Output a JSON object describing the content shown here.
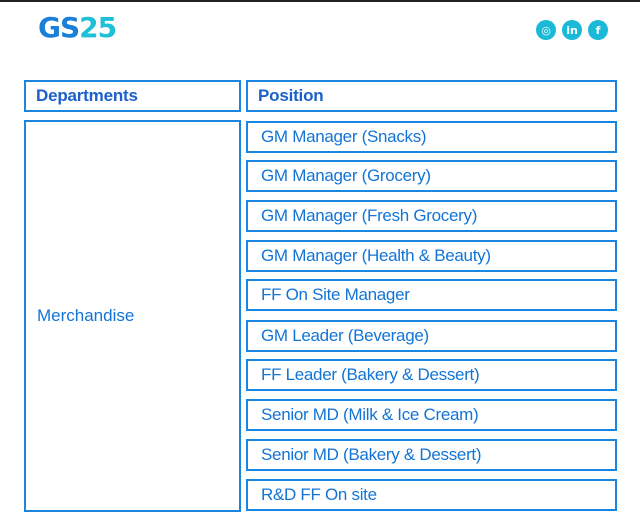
{
  "brand": {
    "logo_gs": "GS",
    "logo_num": "25"
  },
  "social": [
    {
      "icon": "instagram-icon",
      "glyph": "◎"
    },
    {
      "icon": "linkedin-icon",
      "glyph": "in"
    },
    {
      "icon": "facebook-icon",
      "glyph": "f"
    }
  ],
  "colors": {
    "primary": "#1b86e0",
    "header_text": "#1c60c9",
    "body_text": "#1274d6",
    "social": "#1ab9d8",
    "logo_accent": "#1ec0d6"
  },
  "table": {
    "headers": {
      "departments": "Departments",
      "position": "Position"
    },
    "department": "Merchandise",
    "positions": [
      "GM Manager (Snacks)",
      "GM Manager (Grocery)",
      "GM Manager (Fresh Grocery)",
      "GM Manager (Health & Beauty)",
      "FF On Site Manager",
      "GM Leader (Beverage)",
      "FF Leader (Bakery & Dessert)",
      "Senior MD (Milk & Ice Cream)",
      "Senior MD (Bakery & Dessert)",
      "R&D FF On site"
    ]
  }
}
